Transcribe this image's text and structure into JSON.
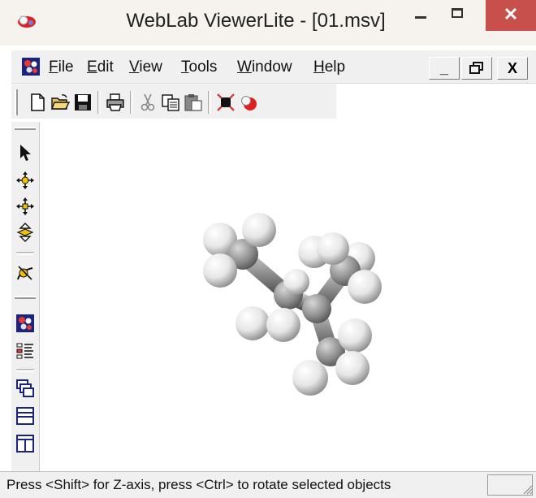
{
  "window": {
    "title": "WebLab ViewerLite - [01.msv]",
    "close_glyph": "✕",
    "colors": {
      "close_bg": "#c7504d",
      "titlebar_bg": "#f6f3ee"
    }
  },
  "menubar": {
    "items": [
      {
        "underline": "F",
        "rest": "ile"
      },
      {
        "underline": "E",
        "rest": "dit"
      },
      {
        "underline": "V",
        "rest": "iew"
      },
      {
        "underline": "T",
        "rest": "ools"
      },
      {
        "underline": "W",
        "rest": "indow"
      },
      {
        "underline": "H",
        "rest": "elp"
      }
    ],
    "mdi_buttons": {
      "minimize": "_",
      "restore": "🗗",
      "close": "X"
    }
  },
  "toolbar": {
    "icons": [
      "new-file-icon",
      "open-folder-icon",
      "save-icon",
      "print-icon",
      "cut-icon",
      "copy-icon",
      "paste-icon",
      "fit-view-icon",
      "molecule-icon"
    ]
  },
  "vtoolbar": {
    "icons": [
      "select-arrow-icon",
      "rotate-icon",
      "translate-icon",
      "zoom-icon",
      "z-rotate-icon",
      "model-props-icon",
      "hierarchy-icon",
      "windows-cascade-icon",
      "tile-horizontal-icon",
      "tile-vertical-icon"
    ]
  },
  "statusbar": {
    "message": "Press <Shift> for Z-axis, press <Ctrl> to rotate selected objects"
  }
}
